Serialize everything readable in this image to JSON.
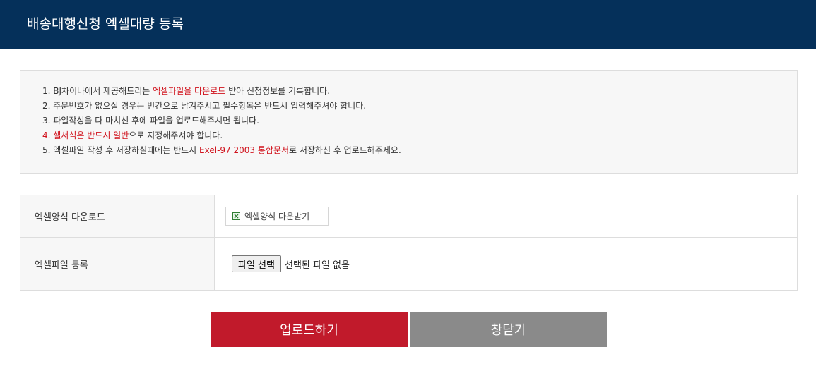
{
  "header": {
    "title": "배송대행신청 엑셀대량 등록"
  },
  "notice": {
    "line1_a": "1. BJ차이나에서 제공해드리는 ",
    "line1_red": "엑셀파일을 다운로드",
    "line1_b": " 받아 신청정보를 기록합니다.",
    "line2": "2. 주문번호가 없으실 경우는 빈칸으로 남겨주시고 필수항목은 반드시 입력해주셔야 합니다.",
    "line3": "3. 파일작성을 다 마치신 후에 파일을 업로드해주시면 됩니다.",
    "line4_red": "4. 셀서식은 반드시 일반",
    "line4_b": "으로 지정해주셔야 합니다.",
    "line5_a": "5. 엑셀파일 작성 후 저장하실때에는 반드시 ",
    "line5_red": "Exel-97 2003 통합문서",
    "line5_b": "로 저장하신 후 업로드해주세요."
  },
  "form": {
    "download_label": "엑셀양식 다운로드",
    "download_button": "엑셀양식 다운받기",
    "upload_label": "엑셀파일 등록",
    "file_button": "파일 선택",
    "file_status": "선택된 파일 없음"
  },
  "actions": {
    "upload": "업로드하기",
    "close": "창닫기"
  },
  "colors": {
    "header_bg": "#05305a",
    "accent_red": "#d0111b",
    "upload_btn": "#c11a2b",
    "close_btn": "#8a8a8a"
  },
  "icons": {
    "download": "excel-file-icon"
  }
}
